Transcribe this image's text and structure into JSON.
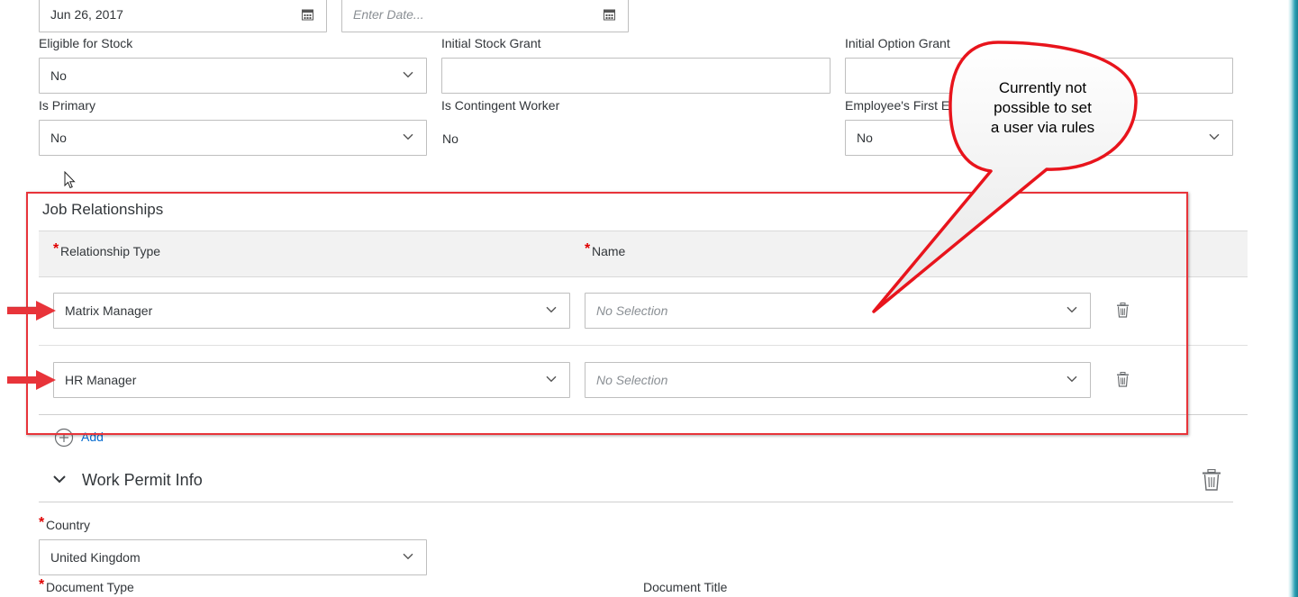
{
  "top_dates": {
    "start_date_value": "Jun 26, 2017",
    "end_date_placeholder": "Enter Date..."
  },
  "fields_row1": {
    "eligible_stock_label": "Eligible for Stock",
    "eligible_stock_value": "No",
    "initial_stock_label": "Initial Stock Grant",
    "initial_stock_value": "",
    "initial_option_label": "Initial Option Grant",
    "initial_option_value": ""
  },
  "fields_row2": {
    "is_primary_label": "Is Primary",
    "is_primary_value": "No",
    "contingent_label": "Is Contingent Worker",
    "contingent_value": "No",
    "first_emp_label": "Employee's First E",
    "first_emp_value": "No"
  },
  "job_relationships": {
    "title": "Job Relationships",
    "col_relationship": "Relationship Type",
    "col_name": "Name",
    "required_mark": "*",
    "rows": [
      {
        "type": "Matrix Manager",
        "name_placeholder": "No Selection"
      },
      {
        "type": "HR Manager",
        "name_placeholder": "No Selection"
      }
    ],
    "add_label": "Add"
  },
  "callout": {
    "lines": [
      "Currently not",
      "possible to set",
      "a user via rules"
    ]
  },
  "work_permit": {
    "title": "Work Permit Info",
    "country_label": "Country",
    "country_value": "United Kingdom",
    "doc_type_label": "Document Type",
    "doc_title_label": "Document Title"
  },
  "colors": {
    "annotation_red": "#e8343a",
    "header_gray": "#f2f2f2",
    "border_gray": "#bfbfbf",
    "accent_teal": "#2a9fb3"
  },
  "icons": {
    "calendar": "calendar-icon",
    "chevron": "chevron-down-icon",
    "trash": "trash-icon",
    "add": "add-circle-icon",
    "cursor": "mouse-cursor-icon"
  }
}
